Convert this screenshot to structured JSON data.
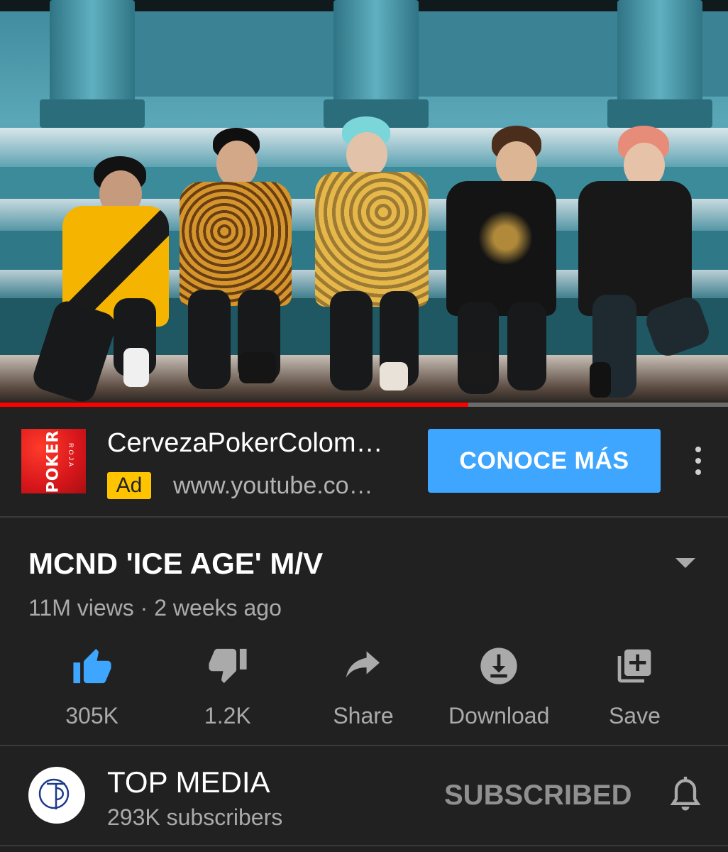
{
  "video": {
    "progress_fraction": 0.643
  },
  "ad": {
    "logo_word": "POKER",
    "logo_sub": "ROJA",
    "title": "CervezaPokerColom…",
    "badge": "Ad",
    "url": "www.youtube.co…",
    "cta_label": "CONOCE MÁS",
    "more_icon": "more-vert-icon"
  },
  "video_info": {
    "title": "MCND 'ICE AGE' M/V",
    "meta": "11M views · 2 weeks ago",
    "expand_icon": "chevron-down-icon"
  },
  "actions": [
    {
      "id": "like",
      "icon": "thumb-up-icon",
      "label": "305K",
      "color": "#3ea6ff",
      "active": true
    },
    {
      "id": "dislike",
      "icon": "thumb-down-icon",
      "label": "1.2K",
      "color": "#aaaaaa",
      "active": false
    },
    {
      "id": "share",
      "icon": "share-icon",
      "label": "Share",
      "color": "#aaaaaa",
      "active": false
    },
    {
      "id": "download",
      "icon": "download-icon",
      "label": "Download",
      "color": "#aaaaaa",
      "active": false
    },
    {
      "id": "save",
      "icon": "playlist-add-icon",
      "label": "Save",
      "color": "#aaaaaa",
      "active": false
    }
  ],
  "channel": {
    "name": "TOP MEDIA",
    "subscribers": "293K subscribers",
    "subscribe_label": "SUBSCRIBED",
    "avatar_text": "TOP MEDIA",
    "bell_icon": "bell-icon"
  },
  "colors": {
    "background": "#212121",
    "accent_blue": "#3ea6ff",
    "progress_red": "#ff0000",
    "ad_badge": "#ffc400"
  }
}
